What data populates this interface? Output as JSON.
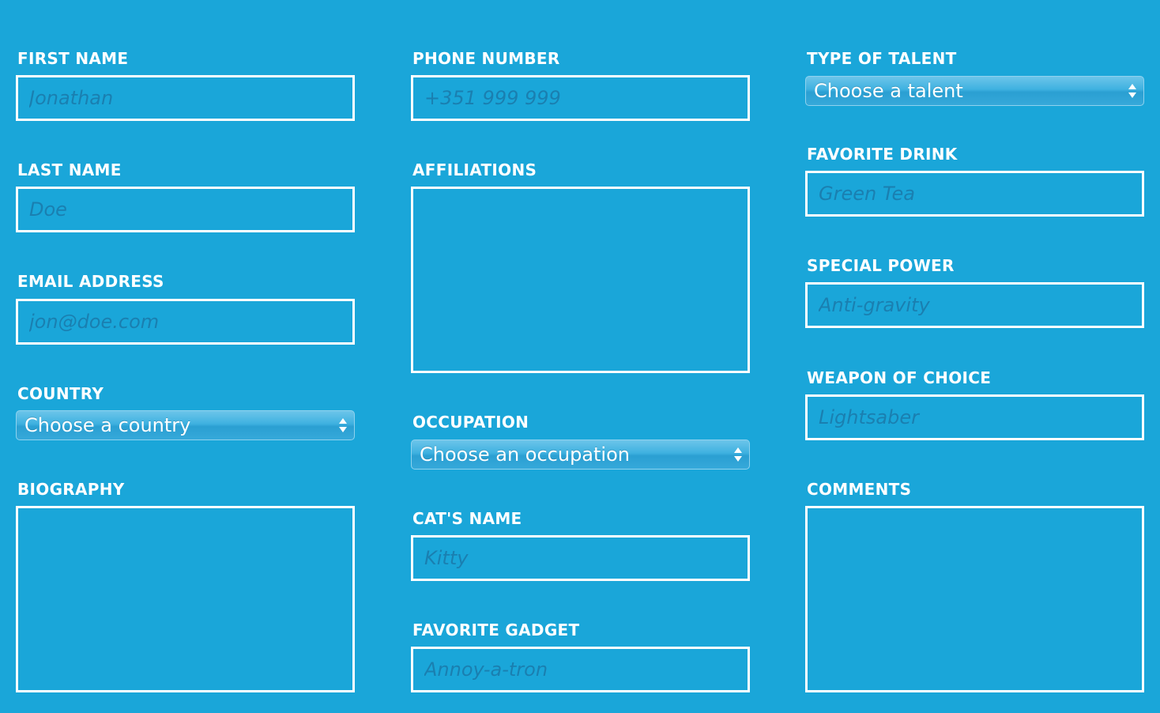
{
  "form": {
    "col1": {
      "first_name": {
        "label": "FIRST NAME",
        "placeholder": "Jonathan"
      },
      "last_name": {
        "label": "LAST NAME",
        "placeholder": "Doe"
      },
      "email": {
        "label": "EMAIL ADDRESS",
        "placeholder": "jon@doe.com"
      },
      "country": {
        "label": "COUNTRY",
        "value": "Choose a country"
      },
      "biography": {
        "label": "BIOGRAPHY"
      }
    },
    "col2": {
      "phone": {
        "label": "PHONE NUMBER",
        "placeholder": "+351 999 999"
      },
      "affiliations": {
        "label": "AFFILIATIONS"
      },
      "occupation": {
        "label": "OCCUPATION",
        "value": "Choose an occupation"
      },
      "cat_name": {
        "label": "CAT'S NAME",
        "placeholder": "Kitty"
      },
      "gadget": {
        "label": "FAVORITE GADGET",
        "placeholder": "Annoy-a-tron"
      }
    },
    "col3": {
      "talent": {
        "label": "TYPE OF TALENT",
        "value": "Choose a talent"
      },
      "drink": {
        "label": "FAVORITE DRINK",
        "placeholder": "Green Tea"
      },
      "power": {
        "label": "SPECIAL POWER",
        "placeholder": "Anti-gravity"
      },
      "weapon": {
        "label": "WEAPON OF CHOICE",
        "placeholder": "Lightsaber"
      },
      "comments": {
        "label": "COMMENTS"
      }
    }
  },
  "colors": {
    "background": "#1aa6d9",
    "border": "#ffffff",
    "placeholder": "#1a7fb0"
  },
  "icons": {
    "select_arrows": "up-down-arrows-icon"
  }
}
